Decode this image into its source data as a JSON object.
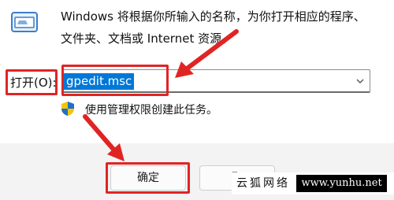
{
  "dialog": {
    "description_line1": "Windows 将根据你所输入的名称，为你打开相应的程序、",
    "description_line2": "文件夹、文档或 Internet 资源。",
    "open_label": "打开(O):",
    "open_value": "gpedit.msc",
    "admin_note": "使用管理权限创建此任务。",
    "ok_label": "确定",
    "cancel_label": "取"
  },
  "colors": {
    "annotation": "#e02424",
    "selection": "#0078d7",
    "button_bar": "#f3f3f3"
  },
  "icons": {
    "app": "run-app-icon",
    "shield": "uac-shield-icon",
    "dropdown": "chevron-down-icon"
  },
  "watermark": {
    "left_text": "云狐网络",
    "right_text": "www.yunhu.net"
  }
}
